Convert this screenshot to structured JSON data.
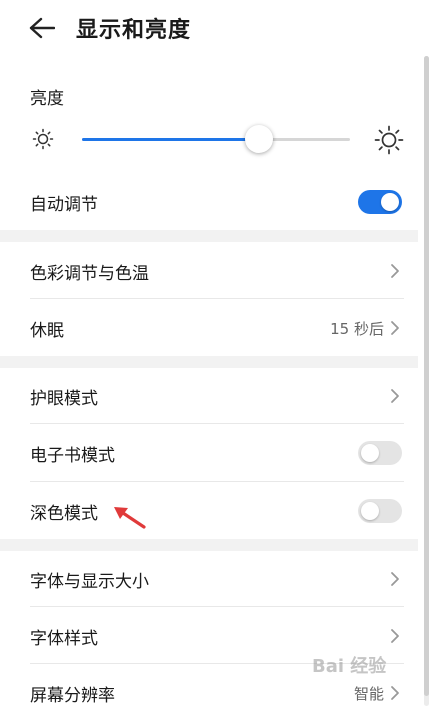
{
  "header": {
    "title": "显示和亮度"
  },
  "brightness": {
    "label": "亮度",
    "level": 0.66
  },
  "rows": [
    {
      "label": "自动调节",
      "type": "toggle",
      "on": true
    },
    {
      "label": "色彩调节与色温",
      "type": "chevron"
    },
    {
      "label": "休眠",
      "type": "chevron",
      "value": "15 秒后"
    },
    {
      "label": "护眼模式",
      "type": "chevron"
    },
    {
      "label": "电子书模式",
      "type": "toggle",
      "on": false
    },
    {
      "label": "深色模式",
      "type": "toggle",
      "on": false
    },
    {
      "label": "字体与显示大小",
      "type": "chevron"
    },
    {
      "label": "字体样式",
      "type": "chevron"
    },
    {
      "label": "屏幕分辨率",
      "type": "chevron",
      "value": "智能"
    }
  ],
  "colors": {
    "accent": "#1e75e8",
    "annotation": "#e03a3a"
  },
  "watermark": "Bai 经验"
}
